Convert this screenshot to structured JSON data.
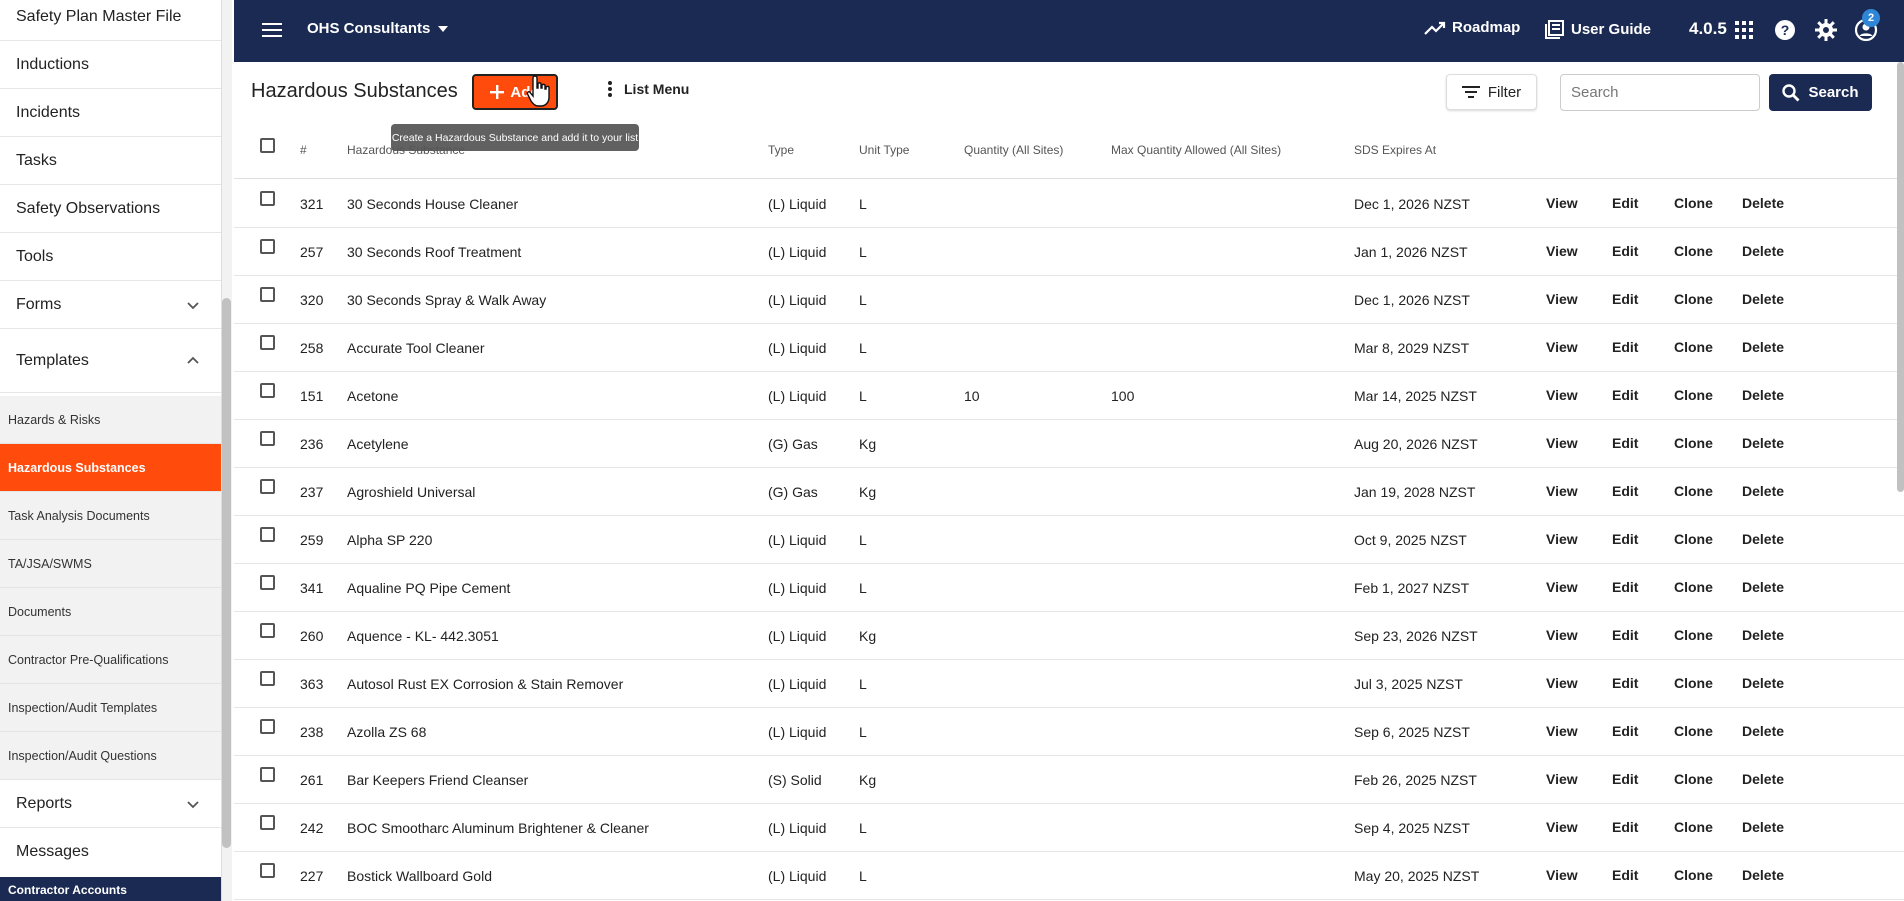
{
  "sidebar": {
    "items_top": [
      {
        "label": "Safety Plan Master File"
      },
      {
        "label": "Inductions"
      },
      {
        "label": "Incidents"
      },
      {
        "label": "Tasks"
      },
      {
        "label": "Safety Observations"
      },
      {
        "label": "Tools"
      },
      {
        "label": "Forms"
      },
      {
        "label": "Templates"
      }
    ],
    "sub_items": [
      {
        "label": "Hazards & Risks"
      },
      {
        "label": "Hazardous Substances"
      },
      {
        "label": "Task Analysis Documents"
      },
      {
        "label": "TA/JSA/SWMS"
      },
      {
        "label": "Documents"
      },
      {
        "label": "Contractor Pre-Qualifications"
      },
      {
        "label": "Inspection/Audit Templates"
      },
      {
        "label": "Inspection/Audit Questions"
      }
    ],
    "items_bottom": [
      {
        "label": "Reports"
      },
      {
        "label": "Messages"
      }
    ],
    "footer": "Contractor Accounts"
  },
  "topbar": {
    "org": "OHS Consultants",
    "roadmap": "Roadmap",
    "user_guide": "User Guide",
    "version": "4.0.5",
    "notification_count": "2"
  },
  "toolbar": {
    "title": "Hazardous Substances",
    "add_label": "Add",
    "list_menu": "List Menu",
    "tooltip": "Create a Hazardous Substance and add it to your list",
    "filter": "Filter",
    "search_placeholder": "Search",
    "search_button": "Search"
  },
  "table": {
    "headers": {
      "num": "#",
      "name": "Hazardous Substance",
      "type": "Type",
      "unit": "Unit Type",
      "qty": "Quantity (All Sites)",
      "max": "Max Quantity Allowed (All Sites)",
      "sds": "SDS Expires At"
    },
    "actions": {
      "view": "View",
      "edit": "Edit",
      "clone": "Clone",
      "delete": "Delete"
    },
    "rows": [
      {
        "num": "321",
        "name": "30 Seconds House Cleaner",
        "type": "(L) Liquid",
        "unit": "L",
        "qty": "",
        "max": "",
        "sds": "Dec 1, 2026 NZST"
      },
      {
        "num": "257",
        "name": "30 Seconds Roof Treatment",
        "type": "(L) Liquid",
        "unit": "L",
        "qty": "",
        "max": "",
        "sds": "Jan 1, 2026 NZST"
      },
      {
        "num": "320",
        "name": "30 Seconds Spray & Walk Away",
        "type": "(L) Liquid",
        "unit": "L",
        "qty": "",
        "max": "",
        "sds": "Dec 1, 2026 NZST"
      },
      {
        "num": "258",
        "name": "Accurate Tool Cleaner",
        "type": "(L) Liquid",
        "unit": "L",
        "qty": "",
        "max": "",
        "sds": "Mar 8, 2029 NZST"
      },
      {
        "num": "151",
        "name": "Acetone",
        "type": "(L) Liquid",
        "unit": "L",
        "qty": "10",
        "max": "100",
        "sds": "Mar 14, 2025 NZST"
      },
      {
        "num": "236",
        "name": "Acetylene",
        "type": "(G) Gas",
        "unit": "Kg",
        "qty": "",
        "max": "",
        "sds": "Aug 20, 2026 NZST"
      },
      {
        "num": "237",
        "name": "Agroshield Universal",
        "type": "(G) Gas",
        "unit": "Kg",
        "qty": "",
        "max": "",
        "sds": "Jan 19, 2028 NZST"
      },
      {
        "num": "259",
        "name": "Alpha SP 220",
        "type": "(L) Liquid",
        "unit": "L",
        "qty": "",
        "max": "",
        "sds": "Oct 9, 2025 NZST"
      },
      {
        "num": "341",
        "name": "Aqualine PQ Pipe Cement",
        "type": "(L) Liquid",
        "unit": "L",
        "qty": "",
        "max": "",
        "sds": "Feb 1, 2027 NZST"
      },
      {
        "num": "260",
        "name": "Aquence - KL- 442.3051",
        "type": "(L) Liquid",
        "unit": "Kg",
        "qty": "",
        "max": "",
        "sds": "Sep 23, 2026 NZST"
      },
      {
        "num": "363",
        "name": "Autosol Rust EX Corrosion & Stain Remover",
        "type": "(L) Liquid",
        "unit": "L",
        "qty": "",
        "max": "",
        "sds": "Jul 3, 2025 NZST"
      },
      {
        "num": "238",
        "name": "Azolla ZS 68",
        "type": "(L) Liquid",
        "unit": "L",
        "qty": "",
        "max": "",
        "sds": "Sep 6, 2025 NZST"
      },
      {
        "num": "261",
        "name": "Bar Keepers Friend Cleanser",
        "type": "(S) Solid",
        "unit": "Kg",
        "qty": "",
        "max": "",
        "sds": "Feb 26, 2025 NZST"
      },
      {
        "num": "242",
        "name": "BOC Smootharc Aluminum Brightener & Cleaner",
        "type": "(L) Liquid",
        "unit": "L",
        "qty": "",
        "max": "",
        "sds": "Sep 4, 2025 NZST"
      },
      {
        "num": "227",
        "name": "Bostick Wallboard Gold",
        "type": "(L) Liquid",
        "unit": "L",
        "qty": "",
        "max": "",
        "sds": "May 20, 2025 NZST"
      }
    ]
  }
}
